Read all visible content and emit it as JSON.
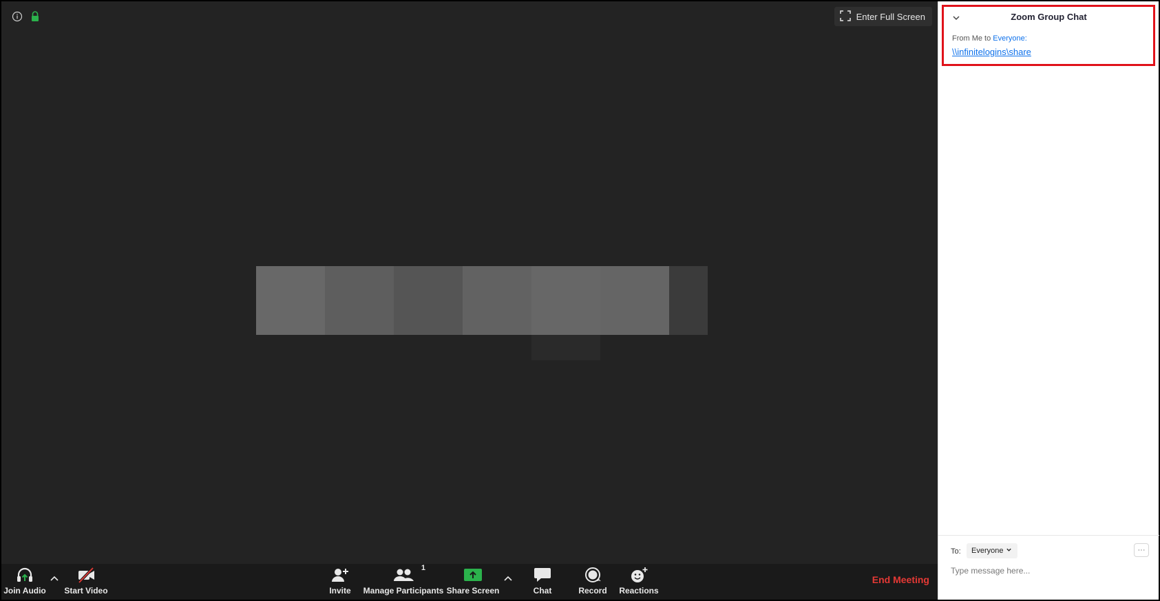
{
  "meeting": {
    "fullscreen_label": "Enter Full Screen",
    "icons": {
      "info": "info-icon",
      "lock": "lock-icon",
      "fullscreen": "fullscreen-icon"
    }
  },
  "toolbar": {
    "join_audio": "Join Audio",
    "start_video": "Start Video",
    "invite": "Invite",
    "manage_participants": "Manage Participants",
    "participant_count": "1",
    "share_screen": "Share Screen",
    "chat": "Chat",
    "record": "Record",
    "reactions": "Reactions",
    "end_meeting": "End Meeting",
    "colors": {
      "share_green": "#2bb24c",
      "end_red": "#e53935"
    }
  },
  "chat": {
    "title": "Zoom Group Chat",
    "message": {
      "from_prefix": "From Me to",
      "recipient": "Everyone:",
      "text": "\\\\infinitelogins\\share"
    },
    "to_label": "To:",
    "to_value": "Everyone",
    "more_label": "···",
    "input_placeholder": "Type message here...",
    "highlight_color": "#e0121a"
  }
}
